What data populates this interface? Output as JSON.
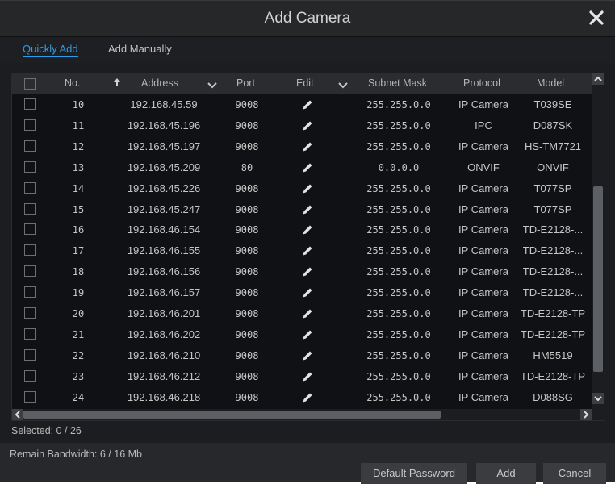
{
  "window": {
    "title": "Add Camera",
    "close_icon": "close-icon"
  },
  "tabs": [
    {
      "label": "Quickly Add",
      "active": true
    },
    {
      "label": "Add Manually",
      "active": false
    }
  ],
  "table": {
    "headers": {
      "no": "No.",
      "address": "Address",
      "port": "Port",
      "edit": "Edit",
      "subnet": "Subnet Mask",
      "protocol": "Protocol",
      "model": "Model"
    },
    "rows": [
      {
        "no": "10",
        "address": "192.168.45.59",
        "port": "9008",
        "subnet": "255.255.0.0",
        "protocol": "IP Camera",
        "model": "T039SE"
      },
      {
        "no": "11",
        "address": "192.168.45.196",
        "port": "9008",
        "subnet": "255.255.0.0",
        "protocol": "IPC",
        "model": "D087SK"
      },
      {
        "no": "12",
        "address": "192.168.45.197",
        "port": "9008",
        "subnet": "255.255.0.0",
        "protocol": "IP Camera",
        "model": "HS-TM7721"
      },
      {
        "no": "13",
        "address": "192.168.45.209",
        "port": "80",
        "subnet": "0.0.0.0",
        "protocol": "ONVIF",
        "model": "ONVIF"
      },
      {
        "no": "14",
        "address": "192.168.45.226",
        "port": "9008",
        "subnet": "255.255.0.0",
        "protocol": "IP Camera",
        "model": "T077SP"
      },
      {
        "no": "15",
        "address": "192.168.45.247",
        "port": "9008",
        "subnet": "255.255.0.0",
        "protocol": "IP Camera",
        "model": "T077SP"
      },
      {
        "no": "16",
        "address": "192.168.46.154",
        "port": "9008",
        "subnet": "255.255.0.0",
        "protocol": "IP Camera",
        "model": "TD-E2128-..."
      },
      {
        "no": "17",
        "address": "192.168.46.155",
        "port": "9008",
        "subnet": "255.255.0.0",
        "protocol": "IP Camera",
        "model": "TD-E2128-..."
      },
      {
        "no": "18",
        "address": "192.168.46.156",
        "port": "9008",
        "subnet": "255.255.0.0",
        "protocol": "IP Camera",
        "model": "TD-E2128-..."
      },
      {
        "no": "19",
        "address": "192.168.46.157",
        "port": "9008",
        "subnet": "255.255.0.0",
        "protocol": "IP Camera",
        "model": "TD-E2128-..."
      },
      {
        "no": "20",
        "address": "192.168.46.201",
        "port": "9008",
        "subnet": "255.255.0.0",
        "protocol": "IP Camera",
        "model": "TD-E2128-TP"
      },
      {
        "no": "21",
        "address": "192.168.46.202",
        "port": "9008",
        "subnet": "255.255.0.0",
        "protocol": "IP Camera",
        "model": "TD-E2128-TP"
      },
      {
        "no": "22",
        "address": "192.168.46.210",
        "port": "9008",
        "subnet": "255.255.0.0",
        "protocol": "IP Camera",
        "model": "HM5519"
      },
      {
        "no": "23",
        "address": "192.168.46.212",
        "port": "9008",
        "subnet": "255.255.0.0",
        "protocol": "IP Camera",
        "model": "TD-E2128-TP"
      },
      {
        "no": "24",
        "address": "192.168.46.218",
        "port": "9008",
        "subnet": "255.255.0.0",
        "protocol": "IP Camera",
        "model": "D088SG"
      }
    ]
  },
  "status": {
    "selected": "Selected: 0 / 26"
  },
  "footer": {
    "bandwidth": "Remain Bandwidth: 6 / 16 Mb",
    "default_password": "Default Password",
    "add": "Add",
    "cancel": "Cancel"
  },
  "colors": {
    "accent": "#2a9ee9",
    "background": "#1b1d20",
    "header": "#2a2c30"
  }
}
